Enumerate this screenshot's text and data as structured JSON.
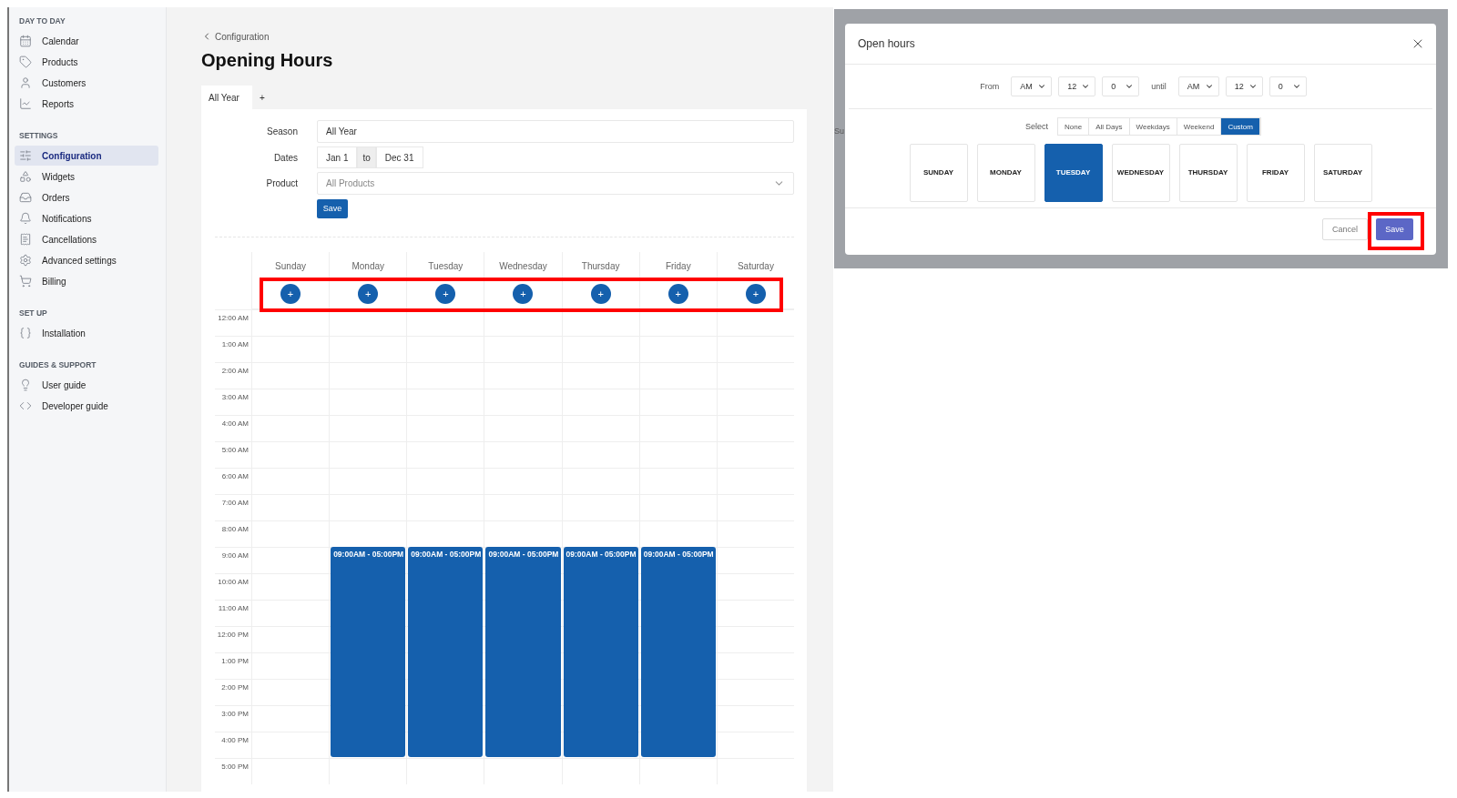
{
  "sidebar": {
    "sections": [
      {
        "heading": "DAY TO DAY",
        "items": [
          {
            "label": "Calendar",
            "selected": false
          },
          {
            "label": "Products",
            "selected": false
          },
          {
            "label": "Customers",
            "selected": false
          },
          {
            "label": "Reports",
            "selected": false
          }
        ]
      },
      {
        "heading": "SETTINGS",
        "items": [
          {
            "label": "Configuration",
            "selected": true
          },
          {
            "label": "Widgets",
            "selected": false
          },
          {
            "label": "Orders",
            "selected": false
          },
          {
            "label": "Notifications",
            "selected": false
          },
          {
            "label": "Cancellations",
            "selected": false
          },
          {
            "label": "Advanced settings",
            "selected": false
          },
          {
            "label": "Billing",
            "selected": false
          }
        ]
      },
      {
        "heading": "SET UP",
        "items": [
          {
            "label": "Installation",
            "selected": false
          }
        ]
      },
      {
        "heading": "GUIDES & SUPPORT",
        "items": [
          {
            "label": "User guide",
            "selected": false
          },
          {
            "label": "Developer guide",
            "selected": false
          }
        ]
      }
    ]
  },
  "breadcrumb": "Configuration",
  "title": "Opening Hours",
  "tabs": [
    {
      "label": "All Year",
      "selected": true
    },
    {
      "label": "+",
      "selected": false
    }
  ],
  "form": {
    "season_label": "Season",
    "season_value": "All Year",
    "dates_label": "Dates",
    "date_from": "Jan 1",
    "date_sep": "to",
    "date_to": "Dec 31",
    "product_label": "Product",
    "product_placeholder": "All Products",
    "save": "Save"
  },
  "calendar": {
    "add_row_highlighted": true,
    "add_symbol": "+",
    "days": [
      {
        "name": "Sunday"
      },
      {
        "name": "Monday",
        "block": {
          "label": "09:00AM - 05:00PM"
        }
      },
      {
        "name": "Tuesday",
        "block": {
          "label": "09:00AM - 05:00PM"
        }
      },
      {
        "name": "Wednesday",
        "block": {
          "label": "09:00AM - 05:00PM"
        }
      },
      {
        "name": "Thursday",
        "block": {
          "label": "09:00AM - 05:00PM"
        }
      },
      {
        "name": "Friday",
        "block": {
          "label": "09:00AM - 05:00PM"
        }
      },
      {
        "name": "Saturday"
      }
    ],
    "hours": [
      "12:00 AM",
      "1:00 AM",
      "2:00 AM",
      "3:00 AM",
      "4:00 AM",
      "5:00 AM",
      "6:00 AM",
      "7:00 AM",
      "8:00 AM",
      "9:00 AM",
      "10:00 AM",
      "11:00 AM",
      "12:00 PM",
      "1:00 PM",
      "2:00 PM",
      "3:00 PM",
      "4:00 PM",
      "5:00 PM"
    ]
  },
  "dialog": {
    "background_text": "Su",
    "title": "Open hours",
    "from_label": "From",
    "from": [
      "AM",
      "12",
      "0"
    ],
    "until_label": "until",
    "until": [
      "AM",
      "12",
      "0"
    ],
    "select_label": "Select",
    "select_options": [
      {
        "label": "None",
        "selected": false
      },
      {
        "label": "All Days",
        "selected": false
      },
      {
        "label": "Weekdays",
        "selected": false
      },
      {
        "label": "Weekend",
        "selected": false
      },
      {
        "label": "Custom",
        "selected": true
      }
    ],
    "days": [
      {
        "label": "SUNDAY",
        "selected": false
      },
      {
        "label": "MONDAY",
        "selected": false
      },
      {
        "label": "TUESDAY",
        "selected": true
      },
      {
        "label": "WEDNESDAY",
        "selected": false
      },
      {
        "label": "THURSDAY",
        "selected": false
      },
      {
        "label": "FRIDAY",
        "selected": false
      },
      {
        "label": "SATURDAY",
        "selected": false
      }
    ],
    "cancel": "Cancel",
    "save": {
      "label": "Save",
      "highlighted": true
    }
  }
}
